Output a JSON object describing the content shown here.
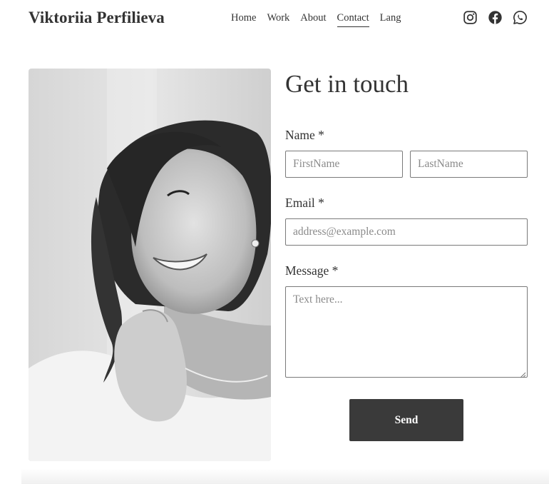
{
  "header": {
    "brand": "Viktoriia Perfilieva",
    "nav": [
      {
        "label": "Home",
        "active": false
      },
      {
        "label": "Work",
        "active": false
      },
      {
        "label": "About",
        "active": false
      },
      {
        "label": "Contact",
        "active": true
      },
      {
        "label": "Lang",
        "active": false
      }
    ],
    "social_icons": [
      "instagram-icon",
      "facebook-icon",
      "whatsapp-icon"
    ]
  },
  "contact": {
    "heading": "Get in touch",
    "name_label": "Name *",
    "first_name_placeholder": "FirstName",
    "last_name_placeholder": "LastName",
    "email_label": "Email *",
    "email_placeholder": "address@example.com",
    "message_label": "Message *",
    "message_placeholder": "Text here...",
    "send_label": "Send"
  },
  "colors": {
    "text": "#333333",
    "button_bg": "#3a3a3a",
    "button_text": "#ffffff",
    "field_border": "#7a7a7a"
  }
}
